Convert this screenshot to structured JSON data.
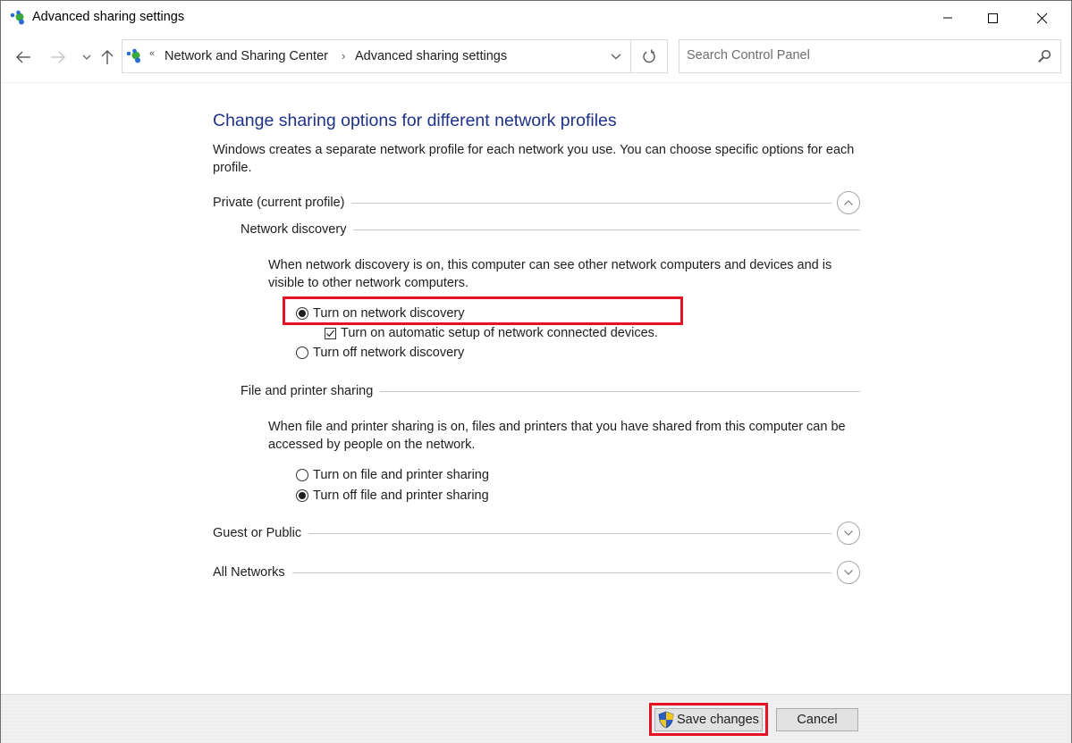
{
  "window": {
    "title": "Advanced sharing settings",
    "controls": {
      "minimize": "minimize",
      "maximize": "maximize",
      "close": "close"
    }
  },
  "nav": {
    "back_icon": "arrow-left-icon",
    "forward_icon": "arrow-right-icon",
    "recent_icon": "chevron-down-icon",
    "up_icon": "arrow-up-icon",
    "address": {
      "overflow_glyph": "«",
      "breadcrumbs": [
        {
          "label": "Network and Sharing Center"
        },
        {
          "label": "Advanced sharing settings"
        }
      ],
      "separator": "›"
    },
    "search": {
      "placeholder": "Search Control Panel",
      "value": ""
    }
  },
  "main": {
    "heading": "Change sharing options for different network profiles",
    "intro": "Windows creates a separate network profile for each network you use. You can choose specific options for each profile.",
    "profiles": [
      {
        "label": "Private (current profile)",
        "expanded": true,
        "sections": [
          {
            "label": "Network discovery",
            "description": "When network discovery is on, this computer can see other network computers and devices and is visible to other network computers.",
            "options": [
              {
                "label": "Turn on network discovery",
                "type": "radio",
                "selected": true,
                "highlighted": true
              },
              {
                "label": "Turn on automatic setup of network connected devices.",
                "type": "checkbox",
                "checked": true
              },
              {
                "label": "Turn off network discovery",
                "type": "radio",
                "selected": false
              }
            ]
          },
          {
            "label": "File and printer sharing",
            "description": "When file and printer sharing is on, files and printers that you have shared from this computer can be accessed by people on the network.",
            "options": [
              {
                "label": "Turn on file and printer sharing",
                "type": "radio",
                "selected": false
              },
              {
                "label": "Turn off file and printer sharing",
                "type": "radio",
                "selected": true
              }
            ]
          }
        ]
      },
      {
        "label": "Guest or Public",
        "expanded": false
      },
      {
        "label": "All Networks",
        "expanded": false
      }
    ]
  },
  "footer": {
    "save_label": "Save changes",
    "save_highlighted": true,
    "cancel_label": "Cancel"
  },
  "colors": {
    "heading": "#1e3287",
    "highlight": "#e81123",
    "footer_bg": "#f0f0f0"
  }
}
